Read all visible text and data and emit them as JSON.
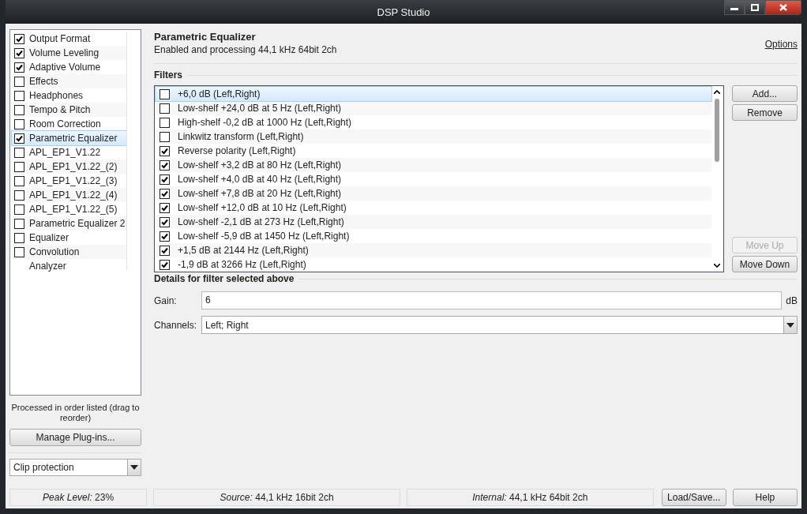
{
  "window": {
    "title": "DSP Studio"
  },
  "sidebar": {
    "items": [
      {
        "label": "Output Format",
        "kind": "check",
        "checked": true,
        "selected": false
      },
      {
        "label": "Volume Leveling",
        "kind": "check",
        "checked": true,
        "selected": false
      },
      {
        "label": "Adaptive Volume",
        "kind": "check",
        "checked": true,
        "selected": false
      },
      {
        "label": "Effects",
        "kind": "check",
        "checked": false,
        "selected": false
      },
      {
        "label": "Headphones",
        "kind": "check",
        "checked": false,
        "selected": false
      },
      {
        "label": "Tempo & Pitch",
        "kind": "check",
        "checked": false,
        "selected": false
      },
      {
        "label": "Room Correction",
        "kind": "check",
        "checked": false,
        "selected": false
      },
      {
        "label": "Parametric Equalizer",
        "kind": "check",
        "checked": true,
        "selected": true
      },
      {
        "label": "APL_EP1_V1.22",
        "kind": "check",
        "checked": false,
        "selected": false
      },
      {
        "label": "APL_EP1_V1.22_(2)",
        "kind": "check",
        "checked": false,
        "selected": false
      },
      {
        "label": "APL_EP1_V1.22_(3)",
        "kind": "check",
        "checked": false,
        "selected": false
      },
      {
        "label": "APL_EP1_V1.22_(4)",
        "kind": "check",
        "checked": false,
        "selected": false
      },
      {
        "label": "APL_EP1_V1.22_(5)",
        "kind": "check",
        "checked": false,
        "selected": false
      },
      {
        "label": "Parametric Equalizer 2",
        "kind": "check",
        "checked": false,
        "selected": false
      },
      {
        "label": "Equalizer",
        "kind": "check",
        "checked": false,
        "selected": false
      },
      {
        "label": "Convolution",
        "kind": "check",
        "checked": false,
        "selected": false
      },
      {
        "label": "Analyzer",
        "kind": "plain",
        "selected": false
      }
    ],
    "note": "Processed in order listed (drag to reorder)",
    "manage_button": "Manage Plug-ins...",
    "clip_dropdown": {
      "value": "Clip protection"
    }
  },
  "header": {
    "title": "Parametric Equalizer",
    "subtitle": "Enabled and processing 44,1 kHz 64bit 2ch",
    "options_link": "Options"
  },
  "filters": {
    "heading": "Filters",
    "rows": [
      {
        "label": "+6,0 dB (Left,Right)",
        "checked": false,
        "selected": true
      },
      {
        "label": "Low-shelf +24,0 dB at 5 Hz (Left,Right)",
        "checked": false,
        "selected": false
      },
      {
        "label": "High-shelf -0,2 dB at 1000 Hz (Left,Right)",
        "checked": false,
        "selected": false
      },
      {
        "label": "Linkwitz transform (Left,Right)",
        "checked": false,
        "selected": false
      },
      {
        "label": "Reverse polarity (Left,Right)",
        "checked": true,
        "selected": false
      },
      {
        "label": "Low-shelf +3,2 dB at 80 Hz (Left,Right)",
        "checked": true,
        "selected": false
      },
      {
        "label": "Low-shelf +4,0 dB at 40 Hz (Left,Right)",
        "checked": true,
        "selected": false
      },
      {
        "label": "Low-shelf +7,8 dB at 20 Hz (Left,Right)",
        "checked": true,
        "selected": false
      },
      {
        "label": "Low-shelf +12,0 dB at 10 Hz (Left,Right)",
        "checked": true,
        "selected": false
      },
      {
        "label": "Low-shelf -2,1 dB at 273 Hz (Left,Right)",
        "checked": true,
        "selected": false
      },
      {
        "label": "Low-shelf -5,9 dB at 1450 Hz (Left,Right)",
        "checked": true,
        "selected": false
      },
      {
        "label": "+1,5 dB at 2144 Hz (Left,Right)",
        "checked": true,
        "selected": false
      },
      {
        "label": "-1,9 dB at 3266 Hz (Left,Right)",
        "checked": true,
        "selected": false
      }
    ],
    "buttons": [
      {
        "label": "Add...",
        "disabled": false
      },
      {
        "label": "Remove",
        "disabled": false
      }
    ],
    "move_buttons": [
      {
        "label": "Move Up",
        "disabled": true
      },
      {
        "label": "Move Down",
        "disabled": false
      }
    ]
  },
  "details": {
    "heading": "Details for filter selected above",
    "gain_label": "Gain:",
    "gain_value": "6",
    "gain_unit": "dB",
    "channels_label": "Channels:",
    "channels_value": "Left; Right"
  },
  "status_bar": {
    "peak": "*Peak Level:* 23%",
    "source": "*Source:* 44,1 kHz 16bit 2ch",
    "internal": "*Internal:* 44,1 kHz 64bit 2ch",
    "buttons": [
      "Load/Save...",
      "Help"
    ]
  }
}
